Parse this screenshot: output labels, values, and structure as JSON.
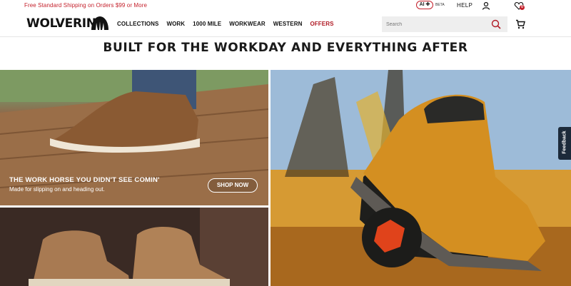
{
  "topbar": {
    "promo": "Free Standard Shipping on Orders $99 or More",
    "ai_label": "AI ✚",
    "beta_label": "BETA",
    "help_label": "HELP",
    "wishlist_count": "0"
  },
  "header": {
    "logo_text": "WOLVERINE",
    "nav": [
      "COLLECTIONS",
      "WORK",
      "1000 MILE",
      "WORKWEAR",
      "WESTERN",
      "OFFERS"
    ],
    "search_placeholder": "Search"
  },
  "main": {
    "headline": "BUILT FOR THE WORKDAY AND EVERYTHING AFTER",
    "tile1": {
      "title": "THE WORK HORSE YOU DIDN'T SEE COMIN'",
      "subtitle": "Made for slipping on and heading out.",
      "cta": "SHOP NOW"
    }
  },
  "feedback_label": "Feedback",
  "colors": {
    "brand_red": "#c4202b",
    "offers_red": "#b01a25"
  },
  "icons": [
    "account-icon",
    "wishlist-icon",
    "search-icon",
    "cart-icon",
    "wolverine-logo-mark"
  ]
}
